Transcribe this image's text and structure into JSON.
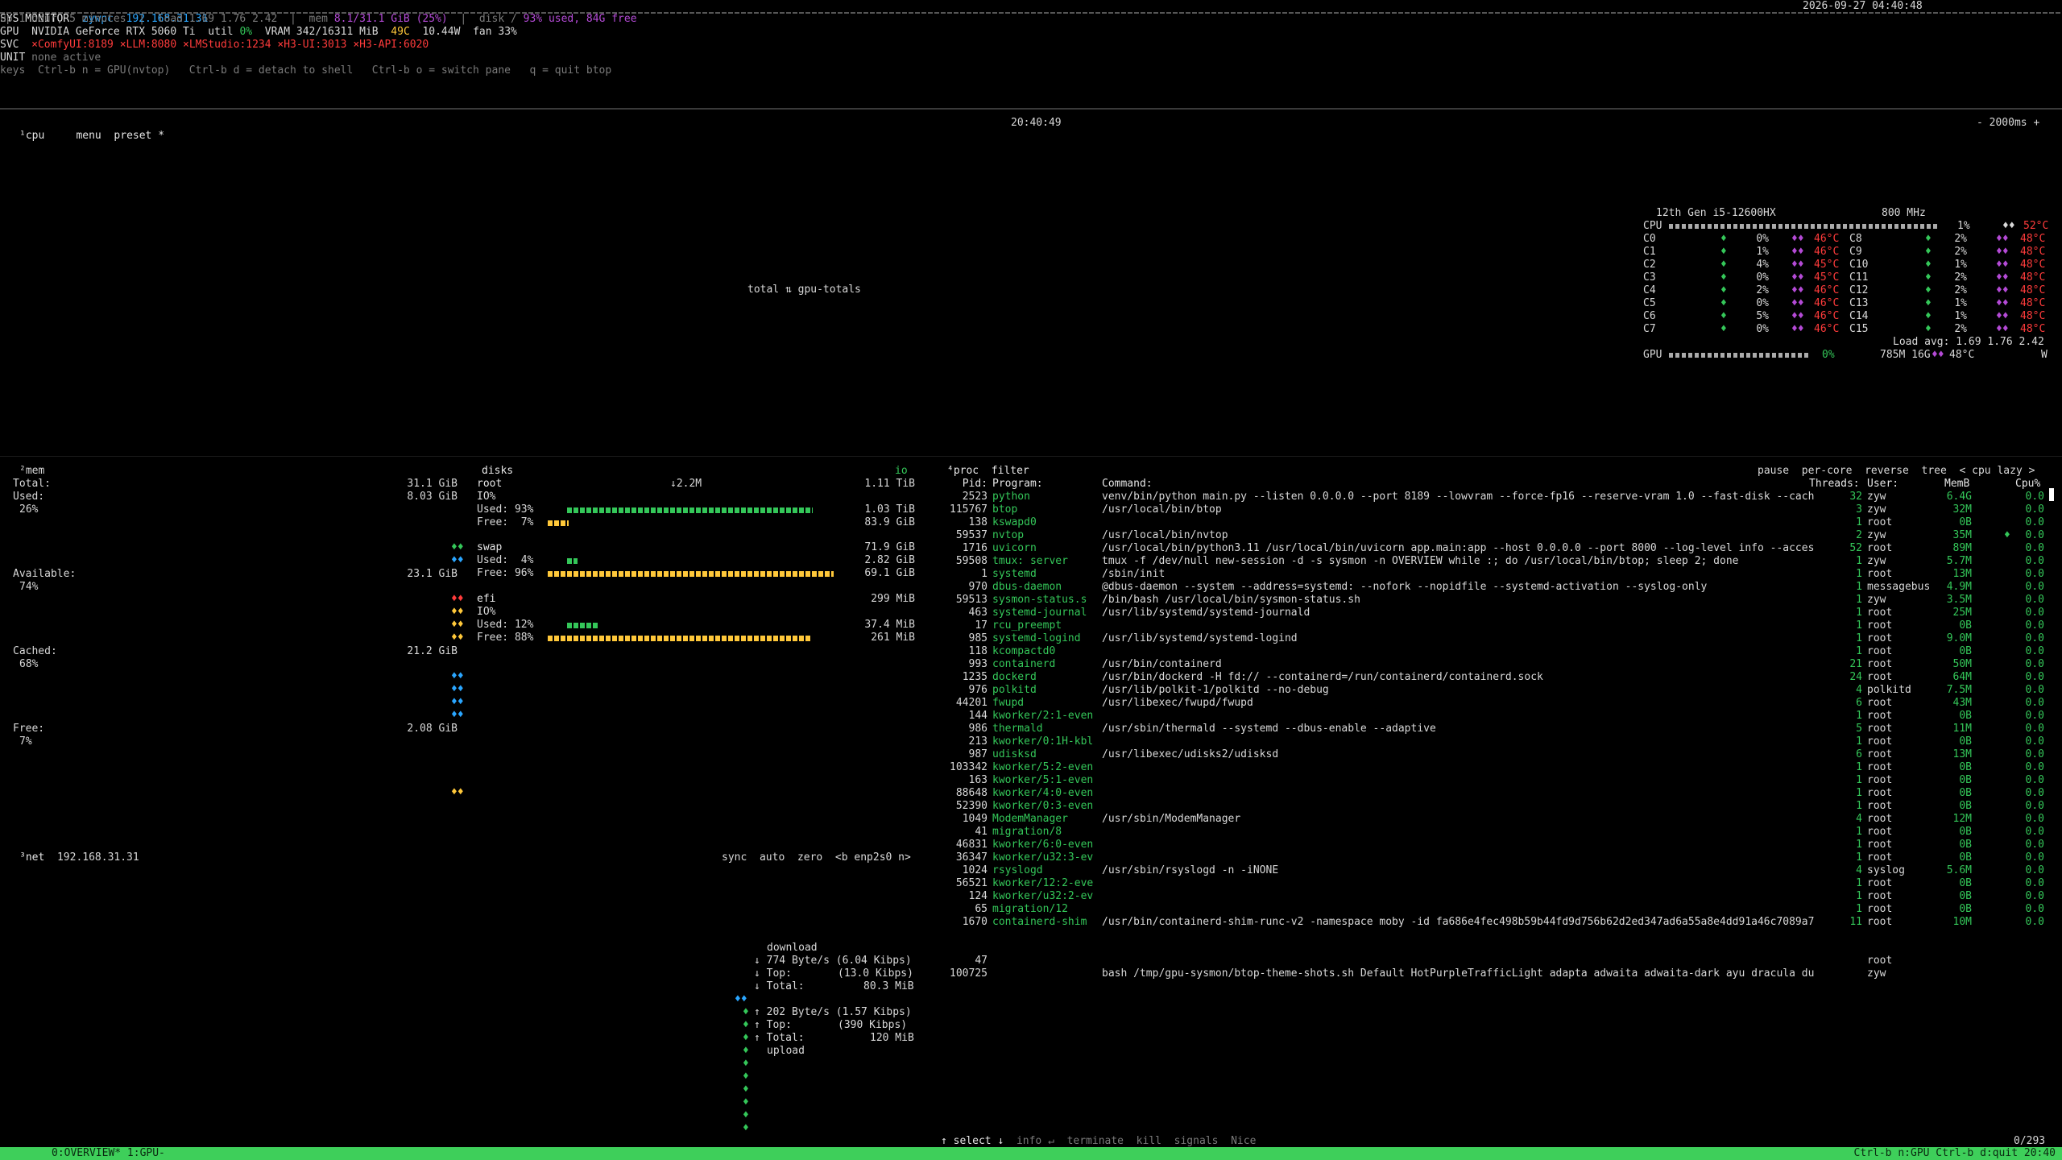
{
  "header": {
    "title": "SYS MONITOR",
    "host": "zywpc",
    "ip": "192.168.31.31",
    "datetime": "2026-09-27 04:40:48",
    "uptime_line": "up 1 hour, 5 minutes  |  load 1.69 1.76 2.42  |  mem ",
    "mem_value": "8.1/31.1 GiB (25%)",
    "disk_prefix": "  |  disk / ",
    "disk_value": "93% used, 84G free",
    "gpu_label": "GPU",
    "gpu_name": "NVIDIA GeForce RTX 5060 Ti",
    "gpu_util_label": "util",
    "gpu_util": "0%",
    "gpu_vram": "VRAM 342/16311 MiB",
    "gpu_temp": "49C",
    "gpu_power": "10.44W",
    "gpu_fan": "fan 33%",
    "svc_label": "SVC",
    "svc_items": [
      "×ComfyUI:8189",
      "×LLM:8080",
      "×LMStudio:1234",
      "×H3-UI:3013",
      "×H3-API:6020"
    ],
    "unit_label": "UNIT",
    "unit_value": "none active",
    "keys_label": "keys",
    "keys_value": "Ctrl-b n = GPU(nvtop)   Ctrl-b d = detach to shell   Ctrl-b o = switch pane   q = quit btop"
  },
  "cpu_panel": {
    "tab": "¹cpu",
    "menu": "menu",
    "preset": "preset *",
    "clock": "20:40:49",
    "interval": "- 2000ms +",
    "graph_label": "total ⇅ gpu-totals",
    "cpu_model": "12th Gen i5-12600HX",
    "freq": "800 MHz",
    "total_label": "CPU",
    "total_pct": "1%",
    "total_temp": "52°C",
    "cores_left": [
      {
        "name": "C0",
        "pct": "0%",
        "temp": "46°C"
      },
      {
        "name": "C1",
        "pct": "1%",
        "temp": "46°C"
      },
      {
        "name": "C2",
        "pct": "4%",
        "temp": "45°C"
      },
      {
        "name": "C3",
        "pct": "0%",
        "temp": "45°C"
      },
      {
        "name": "C4",
        "pct": "2%",
        "temp": "46°C"
      },
      {
        "name": "C5",
        "pct": "0%",
        "temp": "46°C"
      },
      {
        "name": "C6",
        "pct": "5%",
        "temp": "46°C"
      },
      {
        "name": "C7",
        "pct": "0%",
        "temp": "46°C"
      }
    ],
    "cores_right": [
      {
        "name": "C8",
        "pct": "2%",
        "temp": "48°C"
      },
      {
        "name": "C9",
        "pct": "2%",
        "temp": "48°C"
      },
      {
        "name": "C10",
        "pct": "1%",
        "temp": "48°C"
      },
      {
        "name": "C11",
        "pct": "2%",
        "temp": "48°C"
      },
      {
        "name": "C12",
        "pct": "2%",
        "temp": "48°C"
      },
      {
        "name": "C13",
        "pct": "1%",
        "temp": "48°C"
      },
      {
        "name": "C14",
        "pct": "1%",
        "temp": "48°C"
      },
      {
        "name": "C15",
        "pct": "2%",
        "temp": "48°C"
      }
    ],
    "load_avg": "Load avg: 1.69 1.76 2.42",
    "gpu_label": "GPU",
    "gpu_pct": "0%",
    "gpu_mem": "785M 16G",
    "gpu_temp": "48°C",
    "gpu_w": "W"
  },
  "mem_panel": {
    "tab": "²mem",
    "total_label": "Total:",
    "total_value": "31.1 GiB",
    "used_label": "Used:",
    "used_value": "8.03 GiB",
    "used_pct": "26%",
    "avail_label": "Available:",
    "avail_value": "23.1 GiB",
    "avail_pct": "74%",
    "cached_label": "Cached:",
    "cached_value": "21.2 GiB",
    "cached_pct": "68%",
    "free_label": "Free:",
    "free_value": "2.08 GiB",
    "free_pct": "7%"
  },
  "disks_panel": {
    "title": "disks",
    "io_title": "io",
    "io_rate": "↓2.2M",
    "disks": [
      {
        "name": "root",
        "size": "1.11 TiB",
        "io": "IO%",
        "used_label": "Used: 93%",
        "used_val": "1.03 TiB",
        "used_fill": 0.93,
        "free_label": "Free:  7%",
        "free_val": "83.9 GiB",
        "free_fill": 0.07
      },
      {
        "name": "swap",
        "size": "71.9 GiB",
        "io": "",
        "used_label": "Used:  4%",
        "used_val": "2.82 GiB",
        "used_fill": 0.04,
        "free_label": "Free: 96%",
        "free_val": "69.1 GiB",
        "free_fill": 0.96
      },
      {
        "name": "efi",
        "size": "299 MiB",
        "io": "IO%",
        "used_label": "Used: 12%",
        "used_val": "37.4 MiB",
        "used_fill": 0.12,
        "free_label": "Free: 88%",
        "free_val": "261 MiB",
        "free_fill": 0.88
      }
    ]
  },
  "net_panel": {
    "tab": "³net",
    "ip": "192.168.31.31",
    "sync": "sync",
    "auto": "auto",
    "zero": "zero",
    "iface": "<b enp2s0 n>",
    "download_label": "download",
    "dl_rate": "774 Byte/s (6.04 Kibps)",
    "dl_top": "(13.0 Kibps)",
    "dl_total": "80.3 MiB",
    "ul_rate": "202 Byte/s (1.57 Kibps)",
    "ul_top": "(390 Kibps)",
    "ul_total": "120 MiB",
    "upload_label": "upload",
    "top_label": "Top:",
    "total_label": "Total:"
  },
  "proc_panel": {
    "tab": "⁴proc",
    "filter": "filter",
    "pause": "pause",
    "per_core": "per-core",
    "reverse": "reverse",
    "tree": "tree",
    "sort": "< cpu lazy >",
    "headers": {
      "pid": "Pid:",
      "program": "Program:",
      "command": "Command:",
      "threads": "Threads:",
      "user": "User:",
      "mem": "MemB",
      "cpu": "Cpu%"
    },
    "rows": [
      {
        "pid": "2523",
        "program": "python",
        "command": "venv/bin/python main.py --listen 0.0.0.0 --port 8189 --lowvram --force-fp16 --reserve-vram 1.0 --fast-disk --cach",
        "threads": "32",
        "user": "zyw",
        "mem": "6.4G",
        "cpu": "0.0"
      },
      {
        "pid": "115767",
        "program": "btop",
        "command": "/usr/local/bin/btop",
        "threads": "3",
        "user": "zyw",
        "mem": "32M",
        "cpu": "0.0"
      },
      {
        "pid": "138",
        "program": "kswapd0",
        "command": "",
        "threads": "1",
        "user": "root",
        "mem": "0B",
        "cpu": "0.0"
      },
      {
        "pid": "59537",
        "program": "nvtop",
        "command": "/usr/local/bin/nvtop",
        "threads": "2",
        "user": "zyw",
        "mem": "35M",
        "cpu": "0.0"
      },
      {
        "pid": "1716",
        "program": "uvicorn",
        "command": "/usr/local/bin/python3.11 /usr/local/bin/uvicorn app.main:app --host 0.0.0.0 --port 8000 --log-level info --acces",
        "threads": "52",
        "user": "root",
        "mem": "89M",
        "cpu": "0.0"
      },
      {
        "pid": "59508",
        "program": "tmux: server",
        "command": "tmux -f /dev/null new-session -d -s sysmon -n OVERVIEW while :; do /usr/local/bin/btop; sleep 2; done",
        "threads": "1",
        "user": "zyw",
        "mem": "5.7M",
        "cpu": "0.0"
      },
      {
        "pid": "1",
        "program": "systemd",
        "command": "/sbin/init",
        "threads": "1",
        "user": "root",
        "mem": "13M",
        "cpu": "0.0"
      },
      {
        "pid": "970",
        "program": "dbus-daemon",
        "command": "@dbus-daemon --system --address=systemd: --nofork --nopidfile --systemd-activation --syslog-only",
        "threads": "1",
        "user": "messagebus",
        "mem": "4.9M",
        "cpu": "0.0"
      },
      {
        "pid": "59513",
        "program": "sysmon-status.s",
        "command": "/bin/bash /usr/local/bin/sysmon-status.sh",
        "threads": "1",
        "user": "zyw",
        "mem": "3.5M",
        "cpu": "0.0"
      },
      {
        "pid": "463",
        "program": "systemd-journal",
        "command": "/usr/lib/systemd/systemd-journald",
        "threads": "1",
        "user": "root",
        "mem": "25M",
        "cpu": "0.0"
      },
      {
        "pid": "17",
        "program": "rcu_preempt",
        "command": "",
        "threads": "1",
        "user": "root",
        "mem": "0B",
        "cpu": "0.0"
      },
      {
        "pid": "985",
        "program": "systemd-logind",
        "command": "/usr/lib/systemd/systemd-logind",
        "threads": "1",
        "user": "root",
        "mem": "9.0M",
        "cpu": "0.0"
      },
      {
        "pid": "118",
        "program": "kcompactd0",
        "command": "",
        "threads": "1",
        "user": "root",
        "mem": "0B",
        "cpu": "0.0"
      },
      {
        "pid": "993",
        "program": "containerd",
        "command": "/usr/bin/containerd",
        "threads": "21",
        "user": "root",
        "mem": "50M",
        "cpu": "0.0"
      },
      {
        "pid": "1235",
        "program": "dockerd",
        "command": "/usr/bin/dockerd -H fd:// --containerd=/run/containerd/containerd.sock",
        "threads": "24",
        "user": "root",
        "mem": "64M",
        "cpu": "0.0"
      },
      {
        "pid": "976",
        "program": "polkitd",
        "command": "/usr/lib/polkit-1/polkitd --no-debug",
        "threads": "4",
        "user": "polkitd",
        "mem": "7.5M",
        "cpu": "0.0"
      },
      {
        "pid": "44201",
        "program": "fwupd",
        "command": "/usr/libexec/fwupd/fwupd",
        "threads": "6",
        "user": "root",
        "mem": "43M",
        "cpu": "0.0"
      },
      {
        "pid": "144",
        "program": "kworker/2:1-even",
        "command": "",
        "threads": "1",
        "user": "root",
        "mem": "0B",
        "cpu": "0.0"
      },
      {
        "pid": "986",
        "program": "thermald",
        "command": "/usr/sbin/thermald --systemd --dbus-enable --adaptive",
        "threads": "5",
        "user": "root",
        "mem": "11M",
        "cpu": "0.0"
      },
      {
        "pid": "213",
        "program": "kworker/0:1H-kbl",
        "command": "",
        "threads": "1",
        "user": "root",
        "mem": "0B",
        "cpu": "0.0"
      },
      {
        "pid": "987",
        "program": "udisksd",
        "command": "/usr/libexec/udisks2/udisksd",
        "threads": "6",
        "user": "root",
        "mem": "13M",
        "cpu": "0.0"
      },
      {
        "pid": "103342",
        "program": "kworker/5:2-even",
        "command": "",
        "threads": "1",
        "user": "root",
        "mem": "0B",
        "cpu": "0.0"
      },
      {
        "pid": "163",
        "program": "kworker/5:1-even",
        "command": "",
        "threads": "1",
        "user": "root",
        "mem": "0B",
        "cpu": "0.0"
      },
      {
        "pid": "88648",
        "program": "kworker/4:0-even",
        "command": "",
        "threads": "1",
        "user": "root",
        "mem": "0B",
        "cpu": "0.0"
      },
      {
        "pid": "52390",
        "program": "kworker/0:3-even",
        "command": "",
        "threads": "1",
        "user": "root",
        "mem": "0B",
        "cpu": "0.0"
      },
      {
        "pid": "1049",
        "program": "ModemManager",
        "command": "/usr/sbin/ModemManager",
        "threads": "4",
        "user": "root",
        "mem": "12M",
        "cpu": "0.0"
      },
      {
        "pid": "41",
        "program": "migration/8",
        "command": "",
        "threads": "1",
        "user": "root",
        "mem": "0B",
        "cpu": "0.0"
      },
      {
        "pid": "46831",
        "program": "kworker/6:0-even",
        "command": "",
        "threads": "1",
        "user": "root",
        "mem": "0B",
        "cpu": "0.0"
      },
      {
        "pid": "36347",
        "program": "kworker/u32:3-ev",
        "command": "",
        "threads": "1",
        "user": "root",
        "mem": "0B",
        "cpu": "0.0"
      },
      {
        "pid": "1024",
        "program": "rsyslogd",
        "command": "/usr/sbin/rsyslogd -n -iNONE",
        "threads": "4",
        "user": "syslog",
        "mem": "5.6M",
        "cpu": "0.0"
      },
      {
        "pid": "56521",
        "program": "kworker/12:2-eve",
        "command": "",
        "threads": "1",
        "user": "root",
        "mem": "0B",
        "cpu": "0.0"
      },
      {
        "pid": "124",
        "program": "kworker/u32:2-ev",
        "command": "",
        "threads": "1",
        "user": "root",
        "mem": "0B",
        "cpu": "0.0"
      },
      {
        "pid": "65",
        "program": "migration/12",
        "command": "",
        "threads": "1",
        "user": "root",
        "mem": "0B",
        "cpu": "0.0"
      },
      {
        "pid": "1670",
        "program": "containerd-shim",
        "command": "/usr/bin/containerd-shim-runc-v2 -namespace moby -id fa686e4fec498b59b44fd9d756b62d2ed347ad6a55a8e4dd91a46c7089a7",
        "threads": "11",
        "user": "root",
        "mem": "10M",
        "cpu": "0.0"
      }
    ],
    "extra_rows": [
      {
        "pid": "47",
        "command": "",
        "user": "root"
      },
      {
        "pid": "100725",
        "command": "bash /tmp/gpu-sysmon/btop-theme-shots.sh Default HotPurpleTrafficLight adapta adwaita adwaita-dark ayu dracula du",
        "user": "zyw"
      }
    ],
    "footer_select": "↑ select ↓",
    "footer_info": "info ↵",
    "footer_terminate": "terminate",
    "footer_kill": "kill",
    "footer_signals": "signals",
    "footer_nice": "Nice",
    "footer_count": "0/293"
  },
  "statusbar": {
    "left": "0:OVERVIEW* 1:GPU-",
    "right": "Ctrl-b n:GPU  Ctrl-b d:quit  20:40"
  },
  "colors": {
    "accent": "#34c759",
    "magenta": "#b44ad6",
    "bg": "#000000",
    "status_bg": "#3ecf5a"
  }
}
